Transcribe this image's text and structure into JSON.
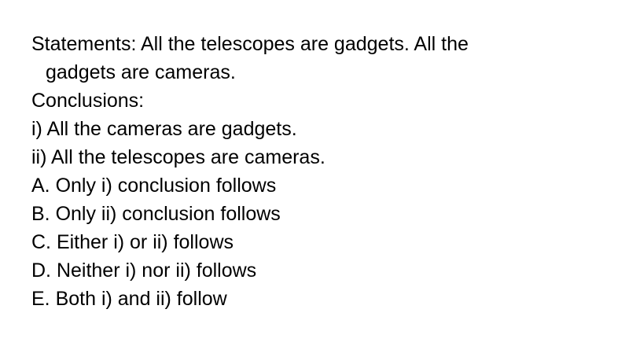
{
  "question": {
    "statements_line1": "Statements: All the telescopes are gadgets. All the",
    "statements_line2": "gadgets are cameras.",
    "conclusions_label": "Conclusions:",
    "conclusions": [
      "i) All the cameras are gadgets.",
      "ii) All the telescopes are cameras."
    ],
    "options": [
      "A. Only i) conclusion follows",
      "B. Only ii) conclusion follows",
      "C. Either i) or ii) follows",
      "D. Neither i) nor ii) follows",
      "E. Both i) and ii) follow"
    ]
  }
}
